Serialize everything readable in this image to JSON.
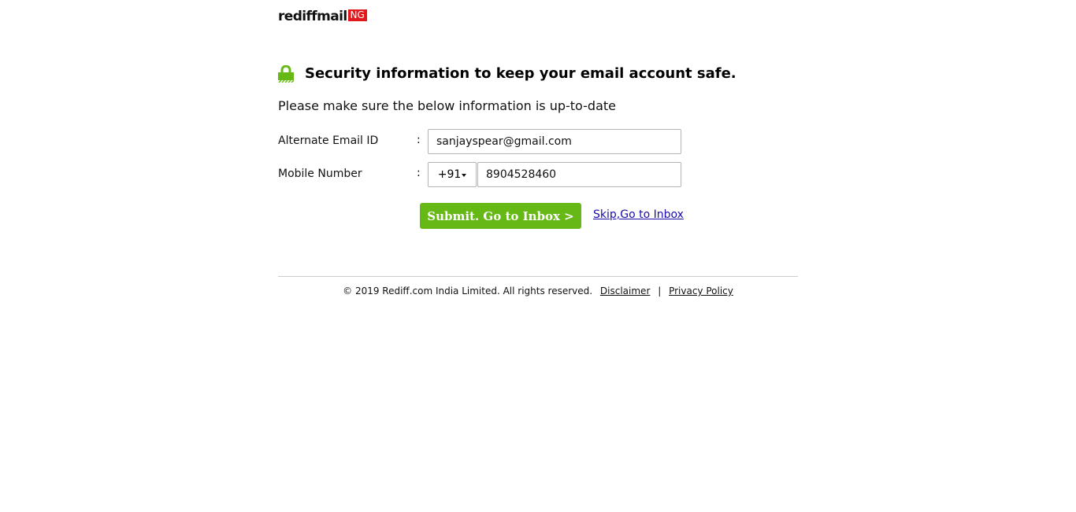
{
  "logo": {
    "text": "rediffmail",
    "badge": "NG"
  },
  "heading": {
    "icon": "lock-icon",
    "title": "Security information to keep your email account safe."
  },
  "subtext": "Please make sure the below information is up-to-date",
  "form": {
    "email": {
      "label": "Alternate Email ID",
      "colon": ":",
      "value": "sanjayspear@gmail.com"
    },
    "mobile": {
      "label": "Mobile Number",
      "colon": ":",
      "country_code": "+91",
      "value": "8904528460"
    }
  },
  "actions": {
    "submit_label": "Submit. Go to Inbox >",
    "skip_label": "Skip,Go to Inbox"
  },
  "footer": {
    "copyright": "© 2019 Rediff.com India Limited. All rights reserved.",
    "disclaimer": "Disclaimer",
    "separator": "|",
    "privacy": "Privacy Policy"
  },
  "colors": {
    "accent_green": "#66b814",
    "badge_red": "#e0191f",
    "link_blue": "#1a0dab"
  }
}
